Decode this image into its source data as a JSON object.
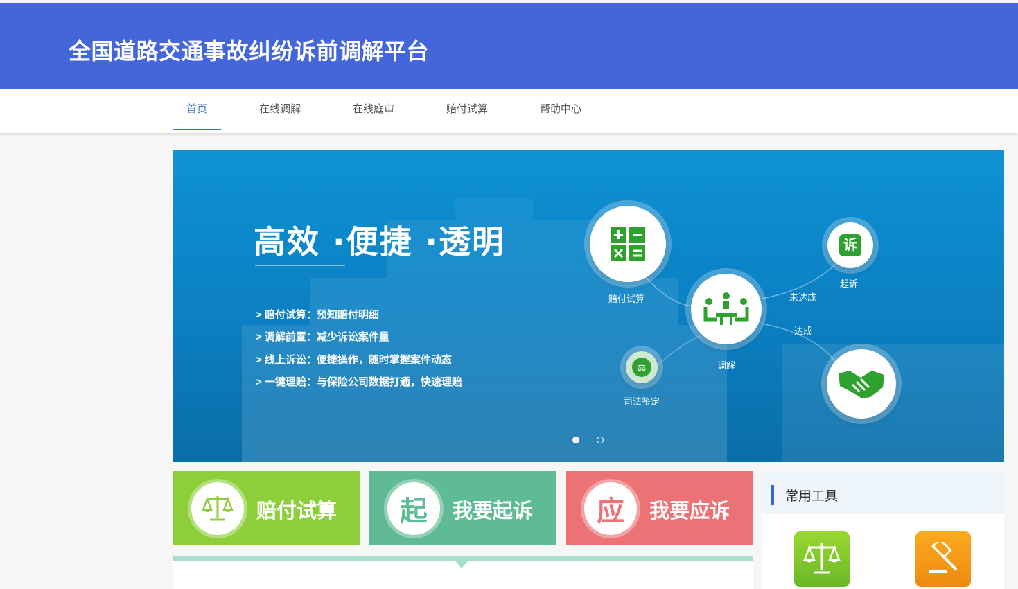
{
  "header": {
    "title": "全国道路交通事故纠纷诉前调解平台"
  },
  "nav": {
    "items": [
      "首页",
      "在线调解",
      "在线庭审",
      "赔付试算",
      "帮助中心"
    ],
    "active_index": 0
  },
  "banner": {
    "slogan": "高效 ·便捷 ·透明",
    "features": [
      "> 赔付试算：预知赔付明细",
      "> 调解前置：减少诉讼案件量",
      "> 线上诉讼：便捷操作，随时掌握案件动态",
      "> 一键理赔：与保险公司数据打通，快速理赔"
    ],
    "flow": {
      "calc": "赔付试算",
      "mediate": "调解",
      "sue": "起诉",
      "sue_icon_char": "诉",
      "judicial": "司法鉴定",
      "not_reached": "未达成",
      "reached": "达成"
    },
    "slide_count": 2,
    "active_slide": 0
  },
  "tiles": [
    {
      "label": "赔付试算",
      "icon": "scale-icon",
      "icon_char": "",
      "color": "#8dcf3a"
    },
    {
      "label": "我要起诉",
      "icon": "sue-char-icon",
      "icon_char": "起",
      "color": "#5fba96"
    },
    {
      "label": "我要应诉",
      "icon": "respond-char-icon",
      "icon_char": "应",
      "color": "#ec7276"
    }
  ],
  "tools": {
    "title": "常用工具",
    "items": [
      {
        "icon": "scale-icon",
        "color": "#7fc72a"
      },
      {
        "icon": "gavel-icon",
        "color": "#f39a16"
      }
    ]
  },
  "colors": {
    "header": "#4466db",
    "nav_active": "#3a76c4",
    "banner": "#0b84c8",
    "accent_green": "#2ea12e"
  }
}
